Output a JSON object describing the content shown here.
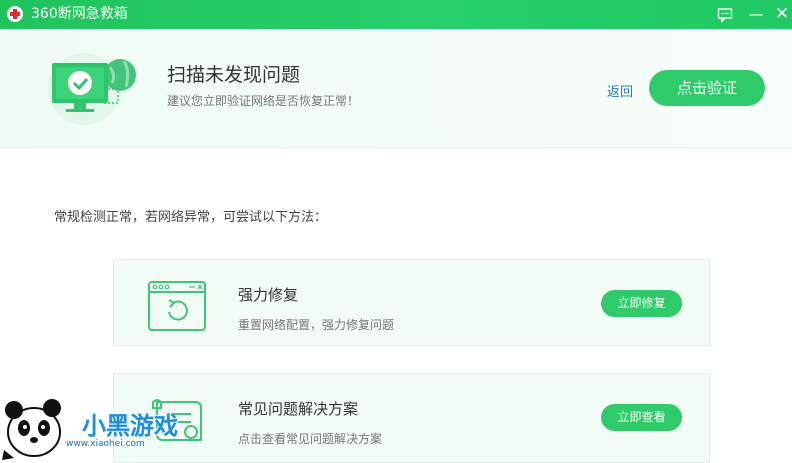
{
  "titlebar": {
    "title": "360断网急救箱",
    "feedback_icon": "feedback-icon",
    "min_label": "—",
    "close_label": "✕"
  },
  "banner": {
    "icon": "monitor-check-icon",
    "title": "扫描未发现问题",
    "subtitle": "建议您立即验证网络是否恢复正常！",
    "back_label": "返回",
    "verify_label": "点击验证"
  },
  "hint": "常规检测正常，若网络异常，可尝试以下方法：",
  "cards": [
    {
      "icon": "repair-window-icon",
      "title": "强力修复",
      "desc": "重置网络配置，强力修复问题",
      "button": "立即修复"
    },
    {
      "icon": "solution-scroll-icon",
      "title": "常见问题解决方案",
      "desc": "点击查看常见问题解决方案",
      "button": "立即查看"
    }
  ],
  "watermark": {
    "brand": "小黑游戏",
    "url": "www.xiaohei.com"
  },
  "colors": {
    "accent": "#2fcb6a",
    "titlebar": "#23c862",
    "link": "#2a75c8"
  }
}
